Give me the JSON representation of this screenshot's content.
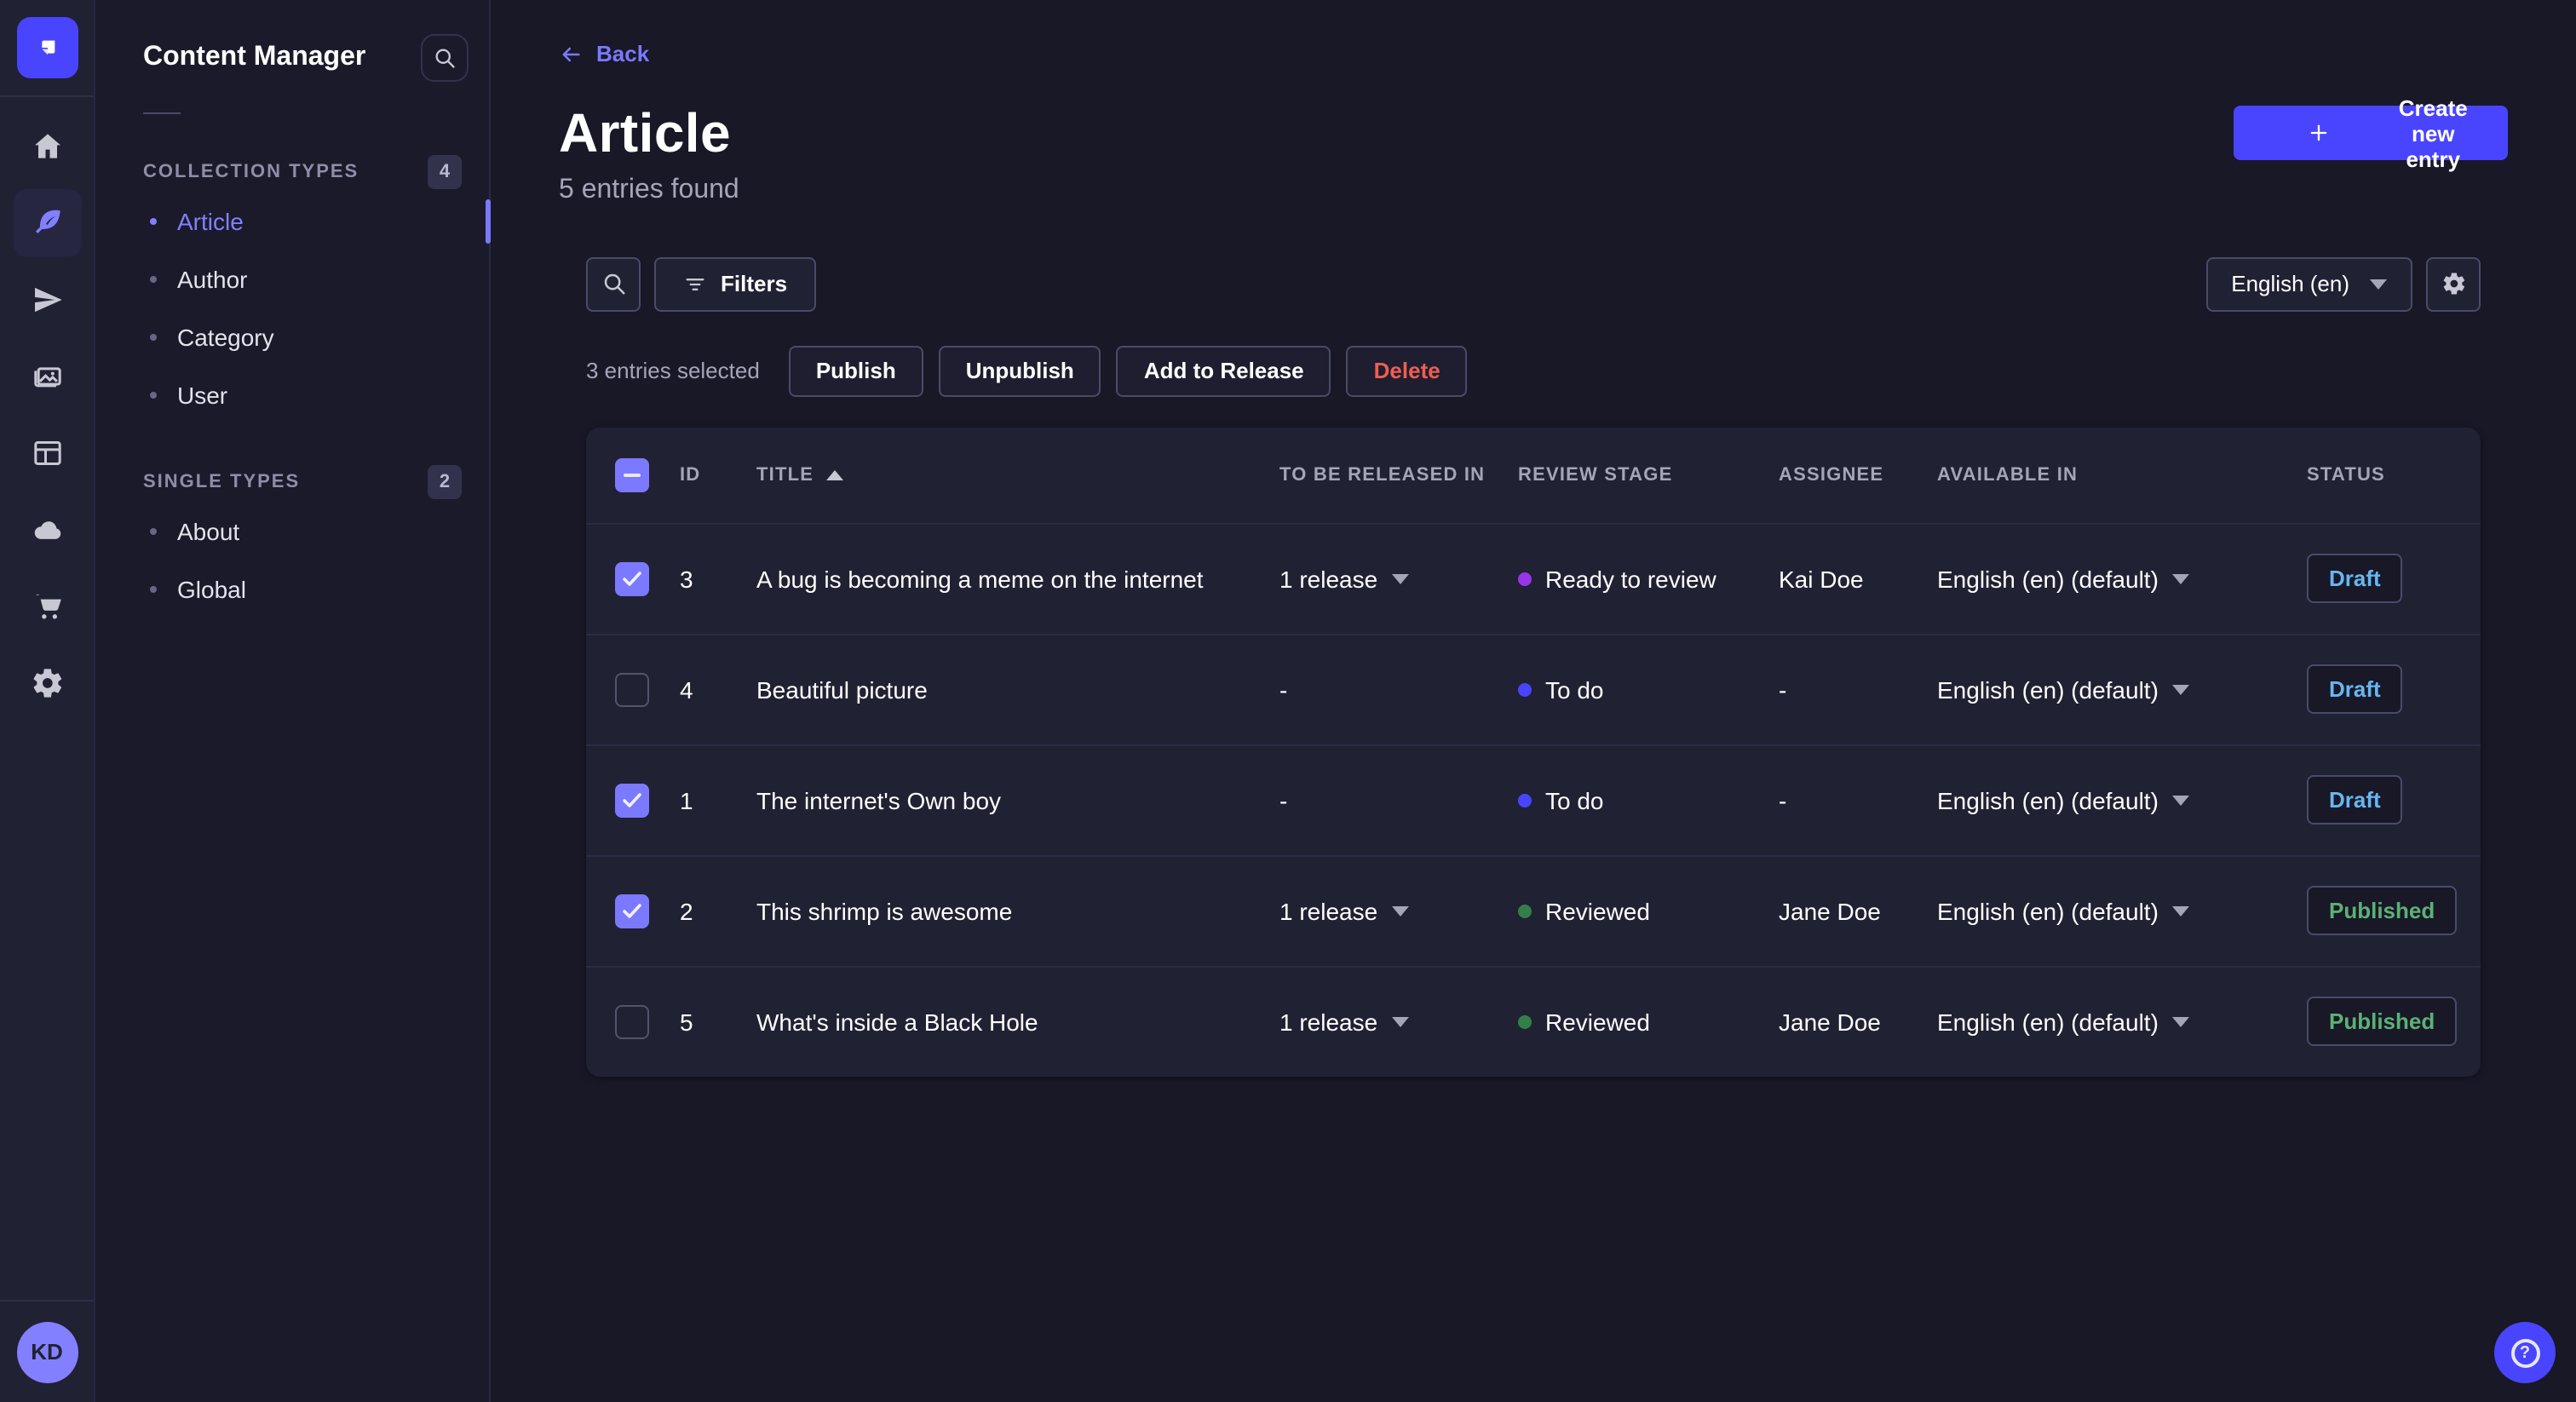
{
  "colors": {
    "accent": "#4945ff",
    "accent_light": "#7b79ff",
    "draft_text": "#66b7f1",
    "published_text": "#5cb176",
    "delete_text": "#ee5e52",
    "stage_ready": "#9736e8",
    "stage_todo": "#4945ff",
    "stage_reviewed": "#328048"
  },
  "rail": {
    "logo_icon": "strapi-logo-icon",
    "items": [
      {
        "icon": "home-icon",
        "active": false
      },
      {
        "icon": "feather-content-icon",
        "active": true
      },
      {
        "icon": "send-plane-icon",
        "active": false
      },
      {
        "icon": "media-library-icon",
        "active": false
      },
      {
        "icon": "content-type-builder-icon",
        "active": false
      },
      {
        "icon": "cloud-deploy-icon",
        "active": false
      },
      {
        "icon": "marketplace-cart-icon",
        "active": false
      },
      {
        "icon": "settings-gear-icon",
        "active": false
      }
    ],
    "avatar_initials": "KD"
  },
  "subnav": {
    "title": "Content Manager",
    "search_icon": "search-icon",
    "sections": [
      {
        "label": "COLLECTION TYPES",
        "badge": "4",
        "items": [
          {
            "label": "Article",
            "active": true
          },
          {
            "label": "Author",
            "active": false
          },
          {
            "label": "Category",
            "active": false
          },
          {
            "label": "User",
            "active": false
          }
        ]
      },
      {
        "label": "SINGLE TYPES",
        "badge": "2",
        "items": [
          {
            "label": "About",
            "active": false
          },
          {
            "label": "Global",
            "active": false
          }
        ]
      }
    ]
  },
  "header": {
    "back_label": "Back",
    "title": "Article",
    "subtitle": "5 entries found",
    "create_button": "Create new entry"
  },
  "toolbar": {
    "filters_label": "Filters",
    "locale_value": "English (en)"
  },
  "selection": {
    "text": "3 entries selected",
    "actions": [
      {
        "label": "Publish",
        "danger": false
      },
      {
        "label": "Unpublish",
        "danger": false
      },
      {
        "label": "Add to Release",
        "danger": false
      },
      {
        "label": "Delete",
        "danger": true
      }
    ]
  },
  "table": {
    "headers": [
      "ID",
      "TITLE",
      "TO BE RELEASED IN",
      "REVIEW STAGE",
      "ASSIGNEE",
      "AVAILABLE IN",
      "STATUS"
    ],
    "sorted_column": "TITLE",
    "sort_direction": "asc",
    "header_checkbox_state": "indeterminate",
    "rows": [
      {
        "checked": true,
        "id": "3",
        "title": "A bug is becoming a meme on the internet",
        "released_in": "1 release",
        "review_stage": "Ready to review",
        "stage_color": "#9736e8",
        "assignee": "Kai Doe",
        "available_in": "English (en) (default)",
        "status": "Draft",
        "status_color": "#66b7f1"
      },
      {
        "checked": false,
        "id": "4",
        "title": "Beautiful picture",
        "released_in": "-",
        "review_stage": "To do",
        "stage_color": "#4945ff",
        "assignee": "-",
        "available_in": "English (en) (default)",
        "status": "Draft",
        "status_color": "#66b7f1"
      },
      {
        "checked": true,
        "id": "1",
        "title": "The internet's Own boy",
        "released_in": "-",
        "review_stage": "To do",
        "stage_color": "#4945ff",
        "assignee": "-",
        "available_in": "English (en) (default)",
        "status": "Draft",
        "status_color": "#66b7f1"
      },
      {
        "checked": true,
        "id": "2",
        "title": "This shrimp is awesome",
        "released_in": "1 release",
        "review_stage": "Reviewed",
        "stage_color": "#328048",
        "assignee": "Jane Doe",
        "available_in": "English (en) (default)",
        "status": "Published",
        "status_color": "#5cb176"
      },
      {
        "checked": false,
        "id": "5",
        "title": "What's inside a Black Hole",
        "released_in": "1 release",
        "review_stage": "Reviewed",
        "stage_color": "#328048",
        "assignee": "Jane Doe",
        "available_in": "English (en) (default)",
        "status": "Published",
        "status_color": "#5cb176"
      }
    ]
  },
  "help": {
    "icon": "help-question-icon"
  }
}
